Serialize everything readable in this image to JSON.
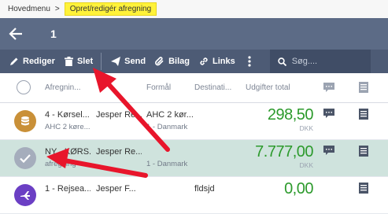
{
  "breadcrumb": {
    "home": "Hovedmenu",
    "separator": ">",
    "current": "Opret/redigér afregning"
  },
  "titlebar": {
    "back_icon": "arrow-left-icon",
    "title": "1"
  },
  "toolbar": {
    "edit_label": "Rediger",
    "delete_label": "Slet",
    "send_label": "Send",
    "attachment_label": "Bilag",
    "links_label": "Links",
    "more_icon": "more-vertical-icon",
    "search_placeholder": "Søg...."
  },
  "columns": {
    "afregning": "Afregnin...",
    "formaal": "Formål",
    "destination": "Destinati...",
    "udgifter": "Udgifter total"
  },
  "rows": [
    {
      "title": "4 - Kørsel...",
      "subtitle": "AHC 2 køre...",
      "person": "Jesper Re...",
      "formaal": "AHC 2 kør...",
      "destination": "1 - Danmark",
      "amount": "298,50",
      "currency": "DKK",
      "avatar_color": "#c99038",
      "avatar_icon": "database-icon"
    },
    {
      "title": "NY - KØRS...",
      "subtitle": "afregning",
      "person": "Jesper Re...",
      "formaal": "",
      "destination": "1 - Danmark",
      "amount": "7.777,00",
      "currency": "DKK",
      "avatar_color": "#a5adbc",
      "avatar_icon": "checkmark-icon"
    },
    {
      "title": "1 - Rejsea...",
      "subtitle": "",
      "person": "Jesper F...",
      "formaal": "",
      "destination": "fldsjd",
      "amount": "0,00",
      "currency": "",
      "avatar_color": "#6b3fc4",
      "avatar_icon": "plane-icon"
    }
  ],
  "colors": {
    "accent": "#fff23a",
    "titlebar": "#5c6b86",
    "toolbar": "#4d5b75",
    "amount": "#2c9a2c",
    "selected_row": "#cfe3dd",
    "annotation_arrow": "#e8152b"
  }
}
